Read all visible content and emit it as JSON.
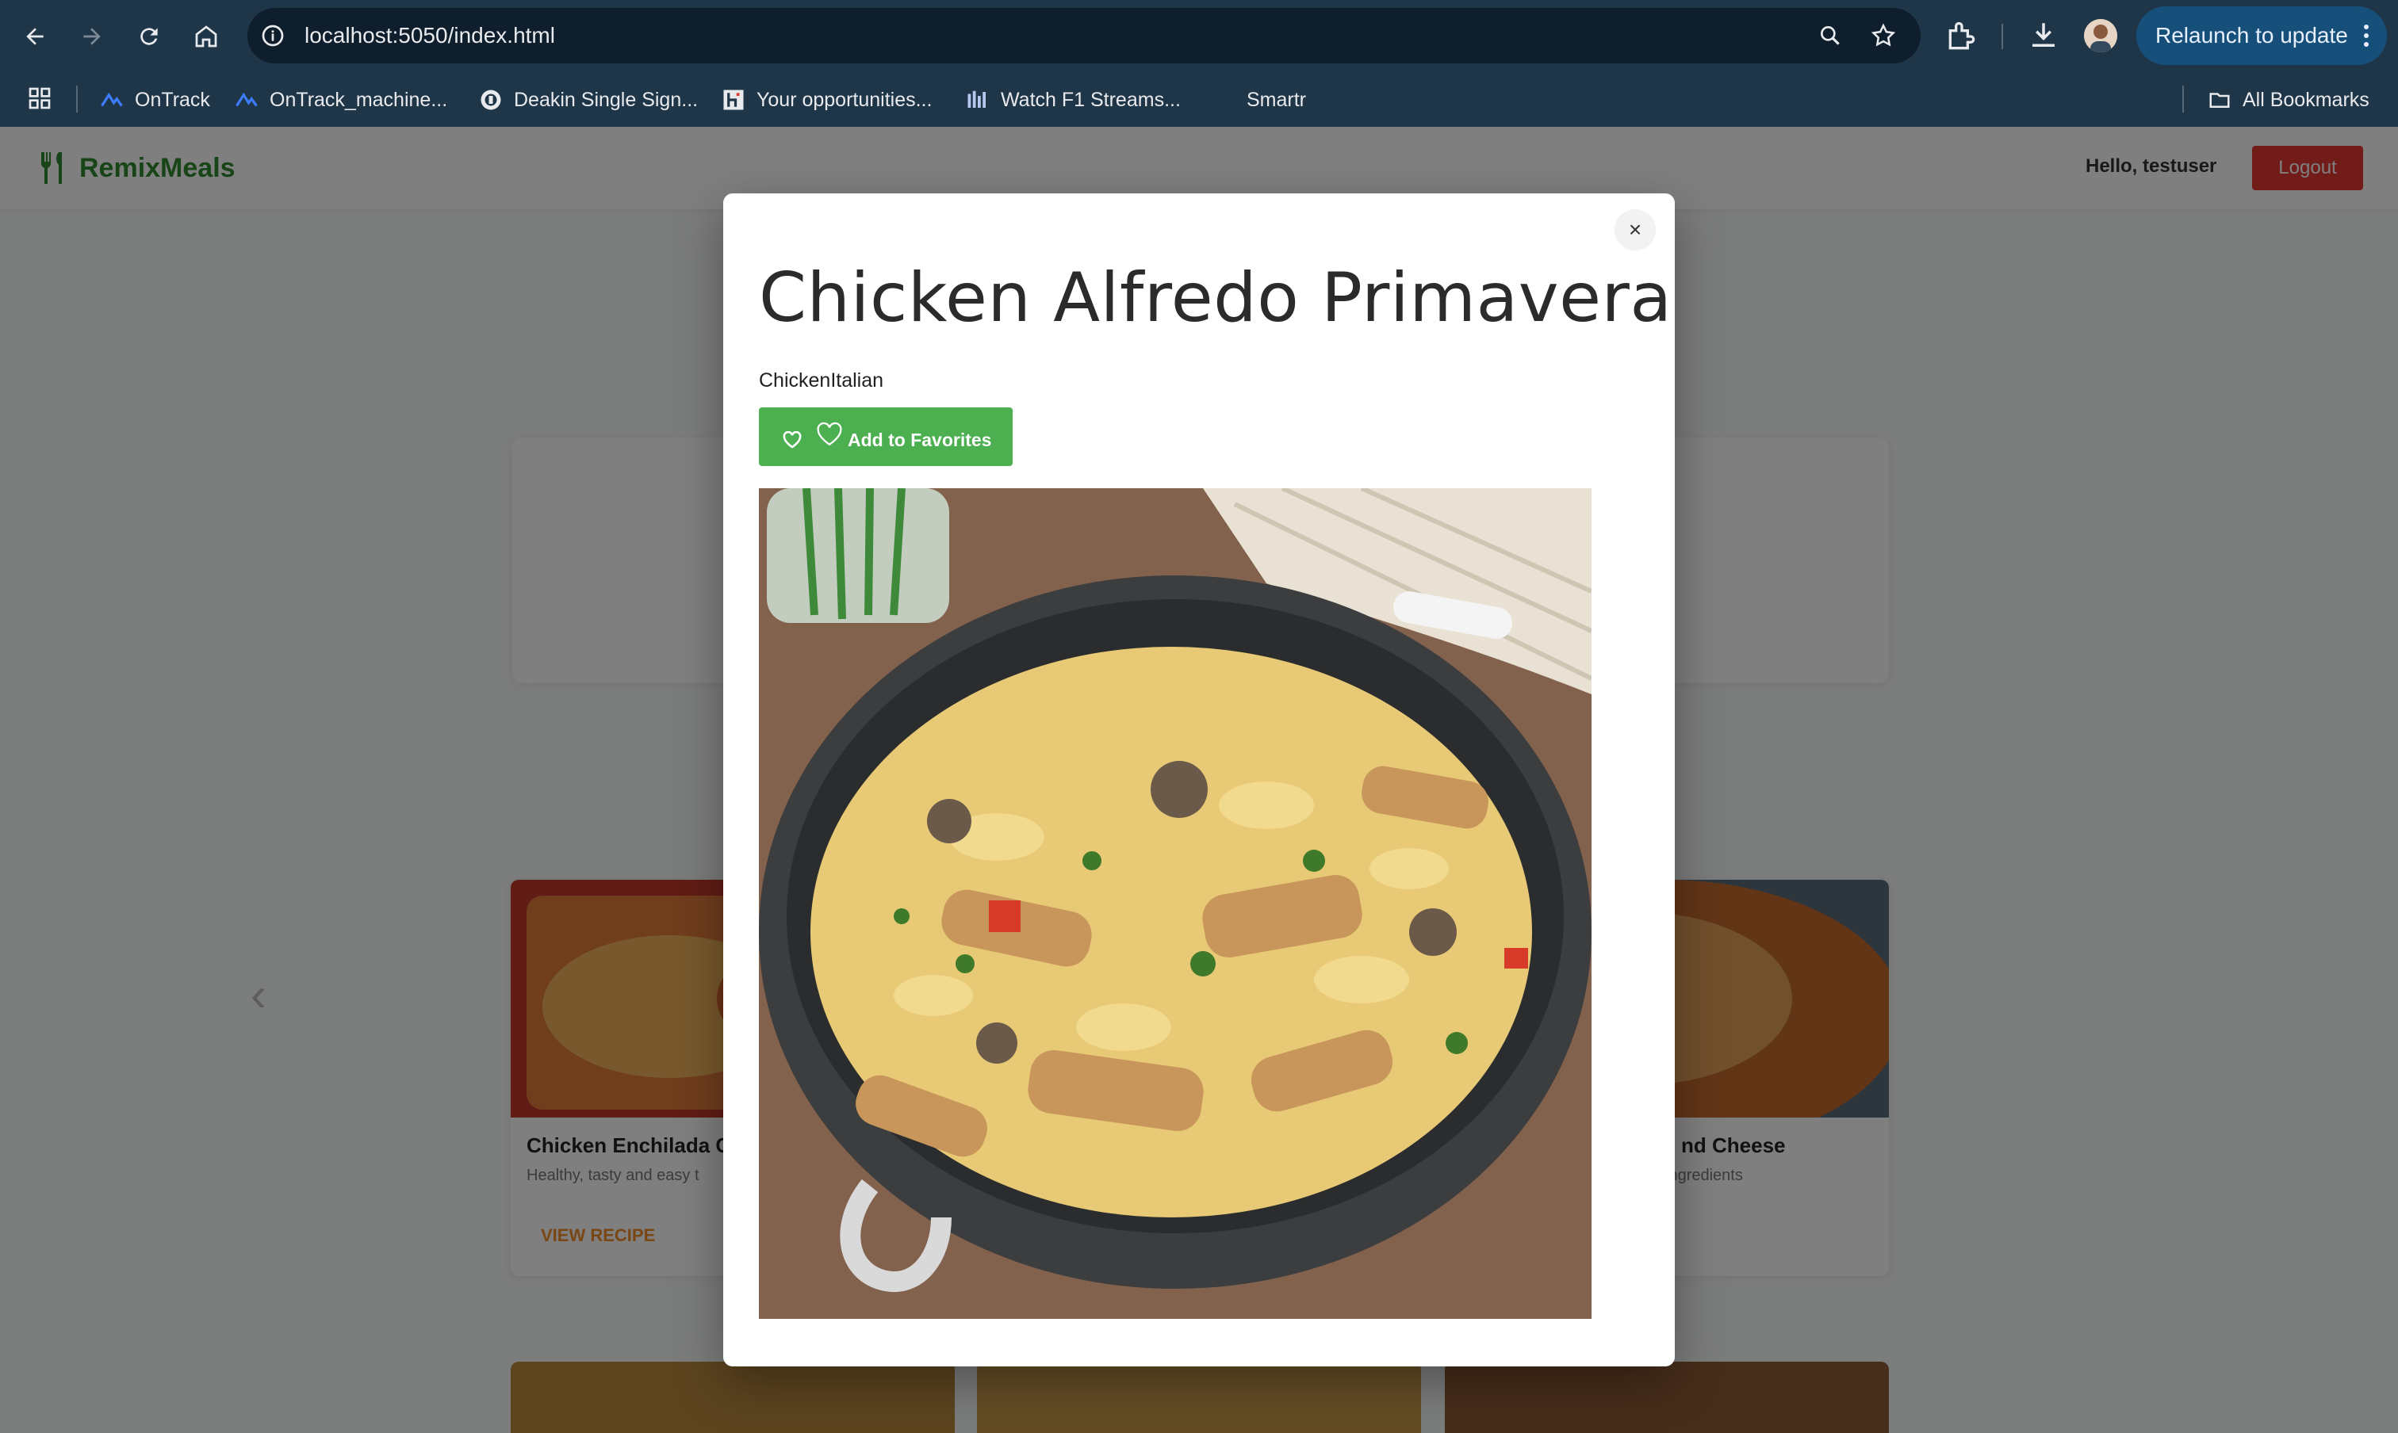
{
  "browser": {
    "url": "localhost:5050/index.html",
    "relaunch_label": "Relaunch to update",
    "bookmarks": [
      "OnTrack",
      "OnTrack_machine...",
      "Deakin Single Sign...",
      "Your opportunities...",
      "Watch F1 Streams...",
      "Smartr"
    ],
    "all_bookmarks_label": "All Bookmarks"
  },
  "app": {
    "logo": "RemixMeals",
    "greeting": "Hello, testuser",
    "logout_label": "Logout"
  },
  "background_cards": [
    {
      "title": "Chicken Enchilada C",
      "desc": "Healthy, tasty and easy t",
      "link": "VIEW RECIPE"
    },
    {
      "title": "nd Cheese",
      "desc": "ingredients"
    }
  ],
  "modal": {
    "close_label": "×",
    "title": "Chicken Alfredo Primavera",
    "tags": "ChickenItalian",
    "favorite_label": "Add to Favorites"
  },
  "colors": {
    "chrome": "#1f3548",
    "accent_green": "#4caf50",
    "logout_red": "#e53935"
  }
}
